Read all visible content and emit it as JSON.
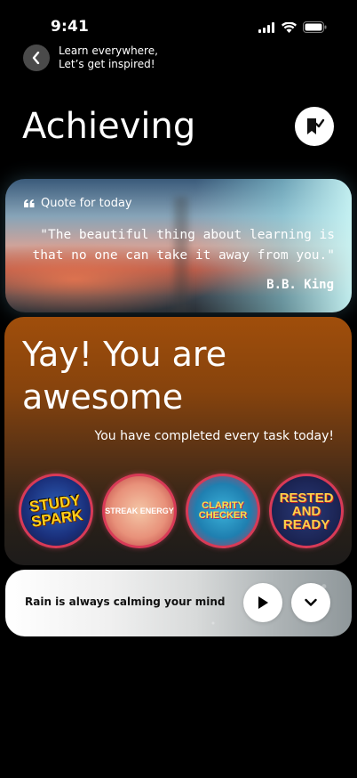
{
  "status_bar": {
    "time": "9:41",
    "icons": [
      "signal-icon",
      "wifi-icon",
      "battery-icon"
    ]
  },
  "header": {
    "back_icon": "chevron-left-icon",
    "line1": "Learn everywhere,",
    "line2": "Let’s get inspired!"
  },
  "page": {
    "title": "Achieving",
    "bookmark_icon": "bookmark-check-icon"
  },
  "quote": {
    "label": "Quote for today",
    "text": "\"The beautiful thing about learning is that no one can take it away from you.\"",
    "author": "B.B. King"
  },
  "achievement": {
    "title": "Yay! You are awesome",
    "subtitle": "You have completed every task today!",
    "badges": [
      {
        "name": "study-spark-badge",
        "text": "STUDY SPARK"
      },
      {
        "name": "streak-energy-badge",
        "text": "STREAK ENERGY"
      },
      {
        "name": "clarity-checker-badge",
        "text": "CLARITY CHECKER"
      },
      {
        "name": "rested-and-ready-badge",
        "text": "RESTED AND READY"
      }
    ]
  },
  "player": {
    "text": "Rain is always calming your mind",
    "play_icon": "play-icon",
    "expand_icon": "chevron-down-icon"
  },
  "colors": {
    "background": "#000000",
    "card_accent": "#a04e0b",
    "badge_border": "#d83a57"
  }
}
